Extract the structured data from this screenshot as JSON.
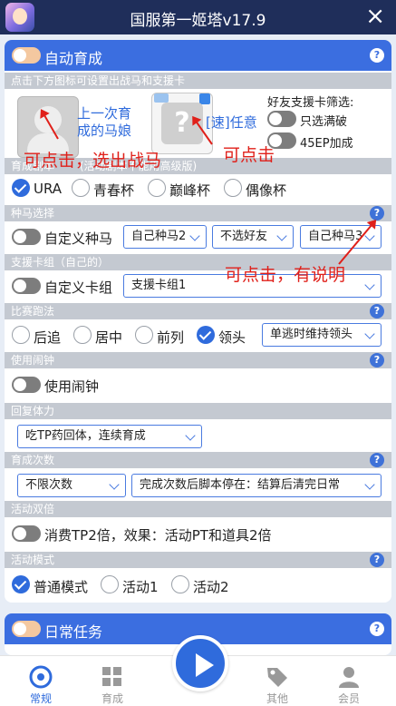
{
  "window": {
    "title": "国服第一姬塔v17.9",
    "close_icon": "×"
  },
  "auto_raise": {
    "title": "自动育成",
    "help_icon": "?",
    "hint": "点击下方图标可设置出战马和支援卡",
    "last_horse_label": "上一次育成的马娘",
    "support_card_label": "[速]任意",
    "friend_filter_title": "好友支援卡筛选:",
    "only_max_break": "只选满破",
    "plus_45ep": "45EP加成",
    "scenario_title": "育成剧本",
    "scenario_note": "(活动剧本不能用高级版)",
    "scenarios": [
      {
        "label": "URA",
        "selected": true
      },
      {
        "label": "青春杯",
        "selected": false
      },
      {
        "label": "巅峰杯",
        "selected": false
      },
      {
        "label": "偶像杯",
        "selected": false
      }
    ],
    "stallion_title": "种马选择",
    "custom_stallion": "自定义种马",
    "stallion_select_1": "自己种马2",
    "stallion_select_2": "不选好友",
    "stallion_select_3": "自己种马3",
    "support_group_title": "支援卡组（自己的）",
    "custom_deck": "自定义卡组",
    "deck_select": "支援卡组1",
    "running_style_title": "比赛跑法",
    "running_styles": [
      {
        "label": "后追",
        "selected": false
      },
      {
        "label": "居中",
        "selected": false
      },
      {
        "label": "前列",
        "selected": false
      },
      {
        "label": "领头",
        "selected": true
      }
    ],
    "running_style_select": "单逃时维持领头",
    "alarm_title": "使用闹钟",
    "use_alarm": "使用闹钟",
    "stamina_title": "回复体力",
    "stamina_select": "吃TP药回体，连续育成",
    "count_title": "育成次数",
    "count_select": "不限次数",
    "after_select": "完成次数后脚本停在：结算后清完日常",
    "double_title": "活动双倍",
    "double_label": "消费TP2倍，效果：活动PT和道具2倍",
    "mode_title": "活动模式",
    "modes": [
      {
        "label": "普通模式",
        "selected": true
      },
      {
        "label": "活动1",
        "selected": false
      },
      {
        "label": "活动2",
        "selected": false
      }
    ]
  },
  "daily": {
    "title": "日常任务",
    "help_icon": "?"
  },
  "annotations": {
    "tap_choose_horse": "可点击，选出战马",
    "tap": "可点击",
    "tap_explain": "可点击，有说明"
  },
  "tabbar": {
    "tabs": [
      {
        "label": "常规",
        "icon": "chrome-icon",
        "active": true
      },
      {
        "label": "育成",
        "icon": "grid-icon",
        "active": false
      },
      {
        "label": "其他",
        "icon": "tag-icon",
        "active": false
      },
      {
        "label": "会员",
        "icon": "user-icon",
        "active": false
      }
    ]
  },
  "colors": {
    "accent": "#3b6ee0",
    "title_bar": "#1f2e5a",
    "annotation": "#e0201a"
  }
}
